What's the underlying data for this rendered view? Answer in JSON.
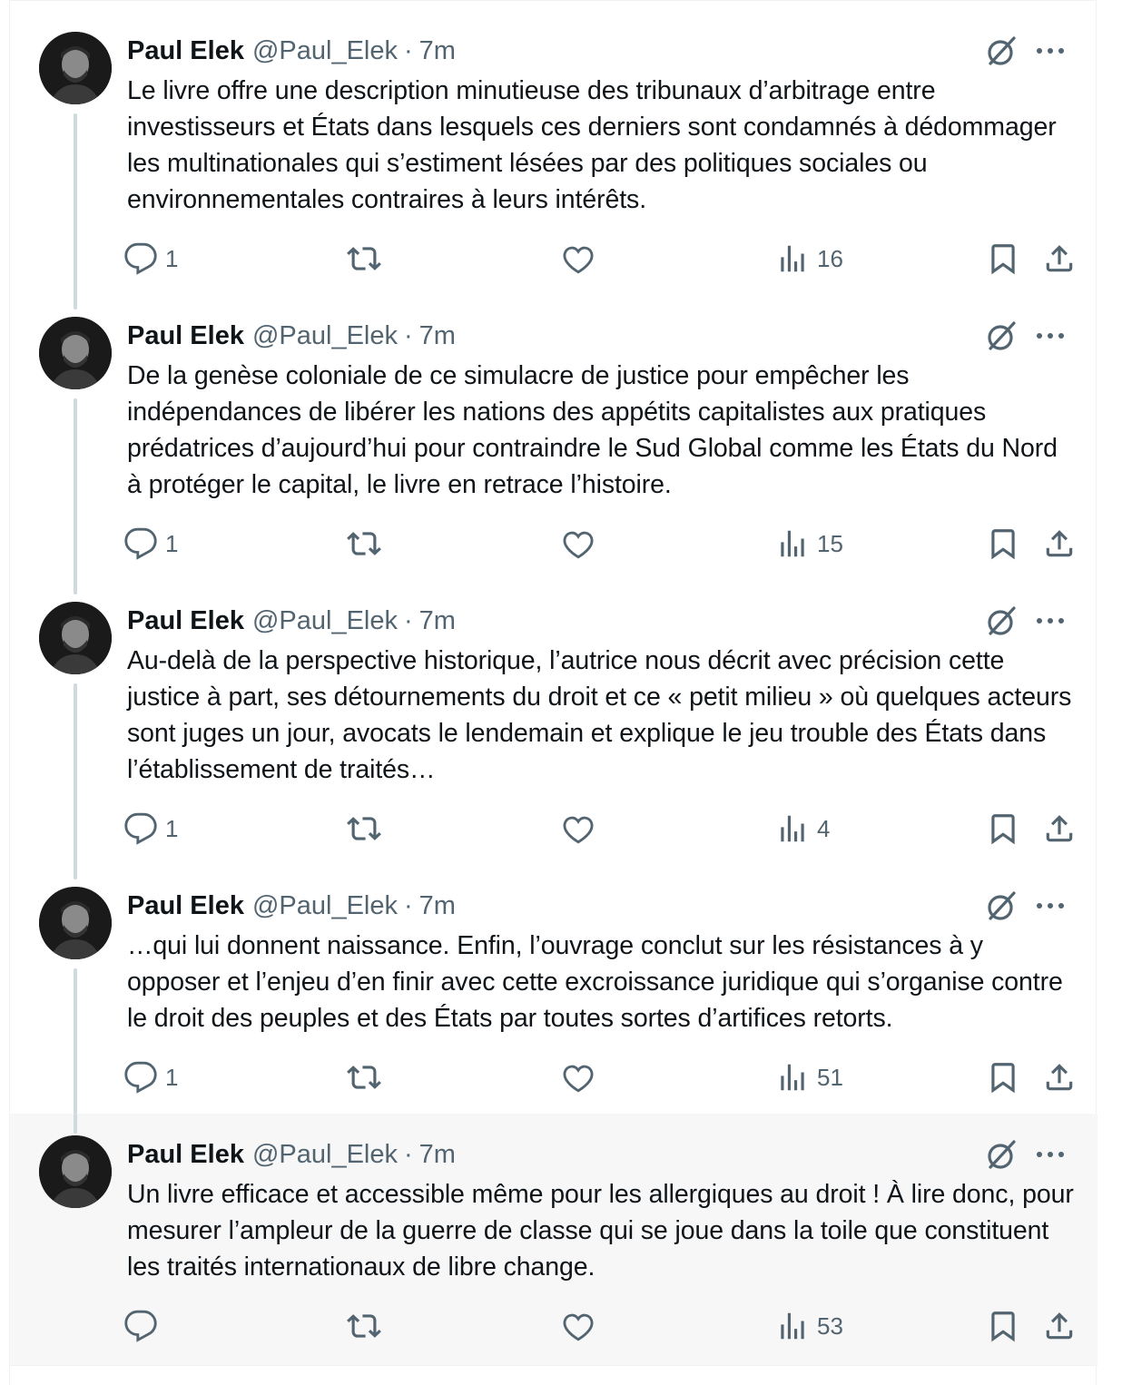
{
  "author": {
    "name": "Paul Elek",
    "handle": "@Paul_Elek",
    "separator": "·",
    "time": "7m"
  },
  "tweets": [
    {
      "text": "Le livre offre une description minutieuse des tribunaux d’arbitrage entre investisseurs et États dans lesquels ces derniers sont condamnés à dédommager les multinationales qui s’estiment lésées par des politiques sociales ou environnementales contraires à leurs intérêts.",
      "replies": "1",
      "views": "16"
    },
    {
      "text": "De la genèse coloniale de ce simulacre de justice pour empêcher les indépendances de libérer les nations des appétits capitalistes aux pratiques prédatrices d’aujourd’hui pour contraindre le Sud Global comme les États du Nord à protéger le capital, le livre en retrace l’histoire.",
      "replies": "1",
      "views": "15"
    },
    {
      "text": "Au-delà de la perspective historique, l’autrice nous décrit avec précision cette justice à part, ses détournements du droit et ce « petit milieu » où quelques acteurs sont juges un jour, avocats le lendemain et explique le jeu trouble des États dans l’établissement de traités…",
      "replies": "1",
      "views": "4"
    },
    {
      "text": "…qui lui donnent naissance. Enfin, l’ouvrage conclut sur les résistances à y opposer et l’enjeu d’en finir avec cette excroissance juridique qui s’organise contre le droit des peuples et des États par toutes sortes d’artifices retorts.",
      "replies": "1",
      "views": "51"
    },
    {
      "text": "Un livre efficace et accessible même pour les allergiques au droit ! À lire donc, pour mesurer l’ampleur de la guerre de classe qui se joue dans la toile que constituent les traités internationaux de libre change.",
      "replies": "",
      "views": "53"
    }
  ],
  "icons": {
    "reply": "reply-icon",
    "retweet": "retweet-icon",
    "like": "like-icon",
    "views": "views-icon",
    "bookmark": "bookmark-icon",
    "share": "share-icon",
    "grok": "grok-icon",
    "more": "more-icon"
  },
  "colors": {
    "text": "#0f1419",
    "secondary": "#536471",
    "thread_line": "#cfd9de",
    "highlight_bg": "#f7f7f7"
  }
}
